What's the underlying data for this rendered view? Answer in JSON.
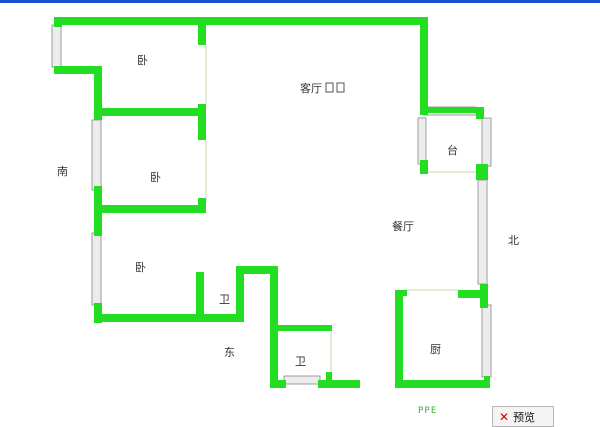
{
  "colors": {
    "wall": "#22dd22",
    "window": "#d9d9d9",
    "accent_bar": "#1f4fd1",
    "close": "#d40000"
  },
  "rooms": {
    "bedroom_1": "卧",
    "bedroom_2": "卧",
    "bedroom_3": "卧",
    "living": "客厅",
    "dining": "餐厅",
    "balcony": "台",
    "bath_1": "卫",
    "bath_2": "卫",
    "kitchen": "厨"
  },
  "directions": {
    "south": "南",
    "north": "北",
    "east": "东"
  },
  "stamp": "PPE",
  "preview": {
    "label": "预览",
    "icon": "close-x-icon"
  }
}
